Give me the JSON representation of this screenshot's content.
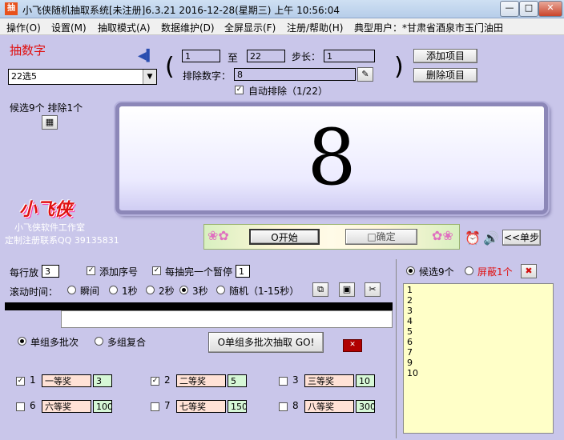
{
  "window": {
    "title": "小飞侠随机抽取系统[未注册]6.3.21  2016-12-28(星期三) 上午  10:56:04",
    "icon_label": "抽",
    "min_label": "—",
    "max_label": "□",
    "close_label": "✕"
  },
  "menu": {
    "items": [
      "操作(O)",
      "设置(M)",
      "抽取模式(A)",
      "数据维护(D)",
      "全屏显示(F)",
      "注册/帮助(H)",
      "典型用户：*甘肃省酒泉市玉门油田"
    ]
  },
  "top": {
    "heading": "抽数字",
    "preset": "22选5",
    "from_value": "1",
    "to_label": "至",
    "to_value": "22",
    "step_label": "步长：",
    "step_value": "1",
    "exclude_label": "排除数字：",
    "exclude_value": "8",
    "auto_exclude_label": "自动排除（1/22）",
    "add_button": "添加项目",
    "delete_button": "删除项目",
    "candidate_info": "候选9个 排除1个"
  },
  "display": {
    "number": "8"
  },
  "brand": {
    "logo_text": "小飞侠",
    "studio": "小飞侠软件工作室",
    "contact": "定制注册联系QQ 39135831"
  },
  "controls": {
    "start_button": "O开始",
    "confirm_button": "□确定",
    "step_button": "<<单步",
    "per_line_label": "每行放",
    "per_line_value": "3",
    "add_serial_label": "添加序号",
    "pause_label": "每抽完一个暂停",
    "pause_value": "1",
    "scroll_label": "滚动时间：",
    "speeds": [
      "瞬间",
      "1秒",
      "2秒",
      "3秒",
      "随机（1-15秒）"
    ],
    "selected_speed": "3秒"
  },
  "right_panel": {
    "candidates_label": "候选9个",
    "hidden_label": "屏蔽1个",
    "candidates": [
      "1",
      "2",
      "3",
      "4",
      "5",
      "6",
      "7",
      "9",
      "10"
    ]
  },
  "mode": {
    "single_label": "单组多批次",
    "multi_label": "多组复合",
    "go_button": "O单组多批次抽取 GO!"
  },
  "prizes": [
    {
      "index": "1",
      "name": "一等奖",
      "count": "3",
      "checked": true
    },
    {
      "index": "2",
      "name": "二等奖",
      "count": "5",
      "checked": true
    },
    {
      "index": "3",
      "name": "三等奖",
      "count": "10",
      "checked": false
    },
    {
      "index": "6",
      "name": "六等奖",
      "count": "100",
      "checked": false
    },
    {
      "index": "7",
      "name": "七等奖",
      "count": "150",
      "checked": false
    },
    {
      "index": "8",
      "name": "八等奖",
      "count": "300",
      "checked": false
    }
  ],
  "colors": {
    "background": "#c9c6ea",
    "list_bg": "#ffffc8",
    "hidden_text": "#e01010",
    "heading_text": "#e01010"
  }
}
